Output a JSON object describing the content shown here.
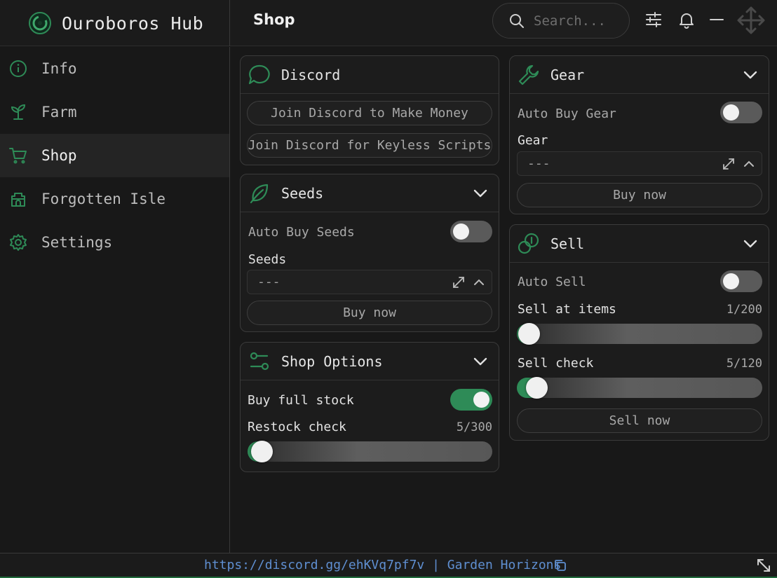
{
  "app": {
    "title": "Ouroboros Hub",
    "page_title": "Shop",
    "accent_color": "#2e8b57",
    "link_color": "#5f8fd1"
  },
  "search": {
    "placeholder": "Search..."
  },
  "topbar_icons": [
    "sliders-icon",
    "bell-icon",
    "minimize-icon",
    "move-icon"
  ],
  "sidebar": {
    "items": [
      {
        "label": "Info",
        "icon": "info-icon",
        "active": false
      },
      {
        "label": "Farm",
        "icon": "sprout-icon",
        "active": false
      },
      {
        "label": "Shop",
        "icon": "cart-icon",
        "active": true
      },
      {
        "label": "Forgotten Isle",
        "icon": "castle-icon",
        "active": false
      },
      {
        "label": "Settings",
        "icon": "gear-icon",
        "active": false
      }
    ]
  },
  "discord": {
    "title": "Discord",
    "buttons": [
      "Join Discord to Make Money",
      "Join Discord for Keyless Scripts"
    ]
  },
  "seeds": {
    "title": "Seeds",
    "auto_buy_label": "Auto Buy Seeds",
    "auto_buy_on": false,
    "dropdown_label": "Seeds",
    "dropdown_value": "---",
    "buy_label": "Buy now"
  },
  "shop_options": {
    "title": "Shop Options",
    "buy_full_stock_label": "Buy full stock",
    "buy_full_stock_on": true,
    "restock_label": "Restock check",
    "restock_value_text": "5/300",
    "restock_fraction": 0.017
  },
  "gear": {
    "title": "Gear",
    "auto_buy_label": "Auto Buy Gear",
    "auto_buy_on": false,
    "dropdown_label": "Gear",
    "dropdown_value": "---",
    "buy_label": "Buy now"
  },
  "sell": {
    "title": "Sell",
    "auto_sell_label": "Auto Sell",
    "auto_sell_on": false,
    "sell_items_label": "Sell at items",
    "sell_items_value_text": "1/200",
    "sell_items_fraction": 0.005,
    "sell_check_label": "Sell check",
    "sell_check_value_text": "5/120",
    "sell_check_fraction": 0.042,
    "sell_now_label": "Sell now"
  },
  "footer": {
    "text": "https://discord.gg/ehKVq7pf7v | Garden Horizons"
  }
}
